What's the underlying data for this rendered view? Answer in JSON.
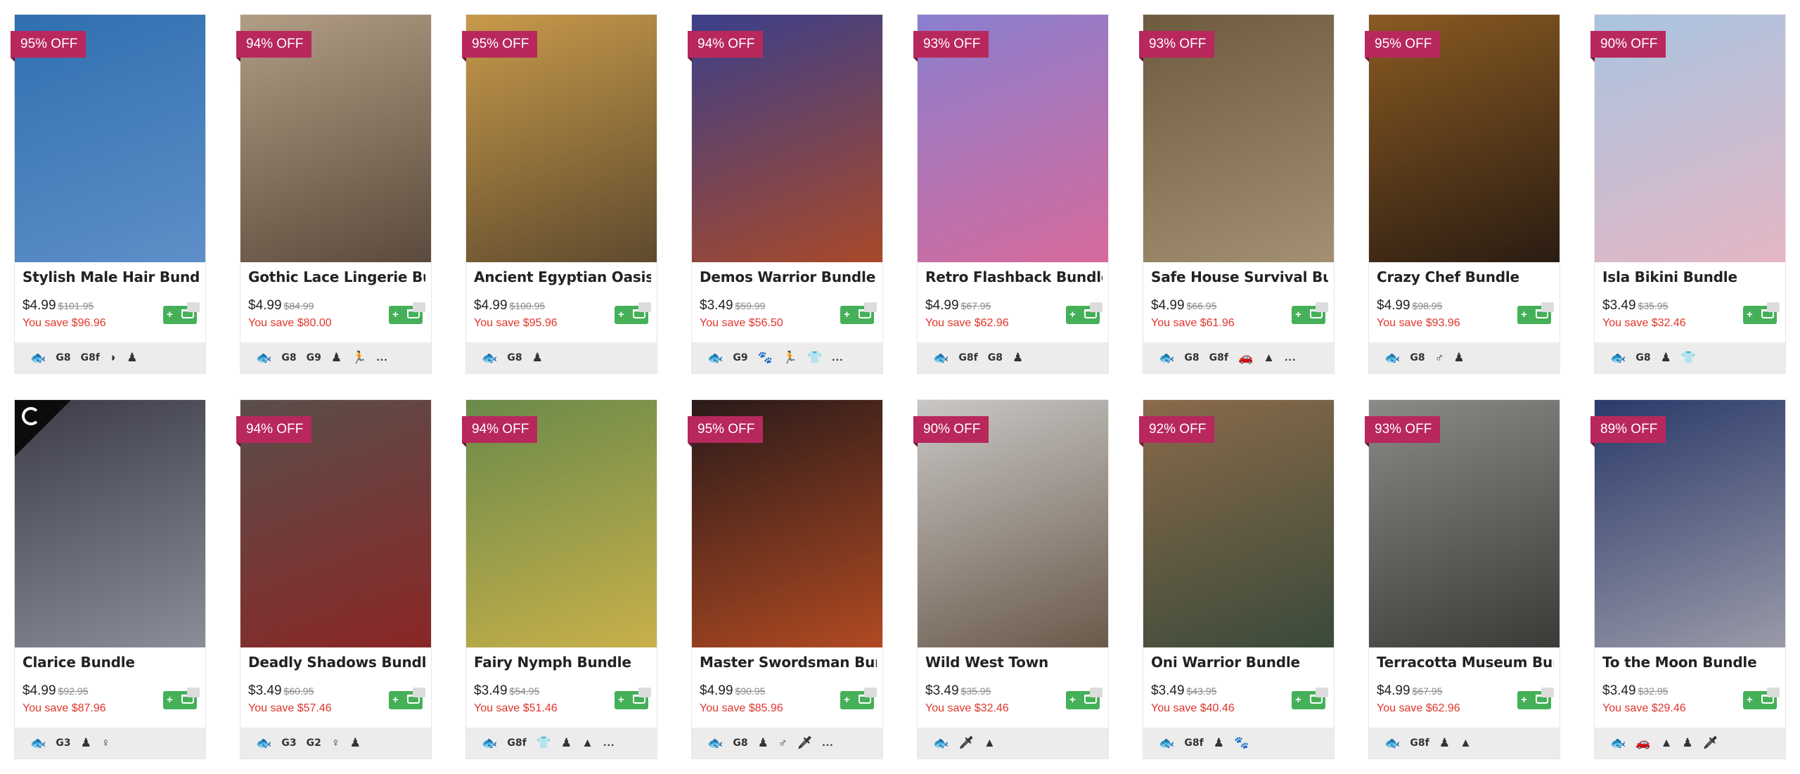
{
  "products": [
    {
      "title": "Stylish Male Hair Bundle",
      "discount": "95% OFF",
      "price": "$4.99",
      "original": "$101.95",
      "save": "You save $96.96",
      "cart": "+",
      "gradient": [
        "#2f6fb0",
        "#5f8fc8"
      ],
      "icons": [
        {
          "name": "fish-icon",
          "label": "🐟"
        },
        {
          "name": "g8-icon",
          "label": "G8"
        },
        {
          "name": "g8f-icon",
          "label": "G8f"
        },
        {
          "name": "hair-icon",
          "label": "◗"
        },
        {
          "name": "figure-icon",
          "label": "♟"
        }
      ]
    },
    {
      "title": "Gothic Lace Lingerie Bu...",
      "discount": "94% OFF",
      "price": "$4.99",
      "original": "$84.99",
      "save": "You save $80.00",
      "cart": "+",
      "gradient": [
        "#b29e84",
        "#5b4a3c"
      ],
      "icons": [
        {
          "name": "fish-icon",
          "label": "🐟"
        },
        {
          "name": "g8-icon",
          "label": "G8"
        },
        {
          "name": "g9-icon",
          "label": "G9"
        },
        {
          "name": "figure-icon",
          "label": "♟"
        },
        {
          "name": "pose-icon",
          "label": "🏃"
        },
        {
          "name": "more-icon",
          "label": "..."
        }
      ]
    },
    {
      "title": "Ancient Egyptian Oasis ...",
      "discount": "95% OFF",
      "price": "$4.99",
      "original": "$100.95",
      "save": "You save $95.96",
      "cart": "+",
      "gradient": [
        "#c89a4a",
        "#5e4a2e"
      ],
      "icons": [
        {
          "name": "fish-icon",
          "label": "🐟"
        },
        {
          "name": "g8-icon",
          "label": "G8"
        },
        {
          "name": "figure-icon",
          "label": "♟"
        }
      ]
    },
    {
      "title": "Demos Warrior Bundle",
      "discount": "94% OFF",
      "price": "$3.49",
      "original": "$59.99",
      "save": "You save $56.50",
      "cart": "+",
      "gradient": [
        "#3b3f8a",
        "#a8492a"
      ],
      "icons": [
        {
          "name": "fish-icon",
          "label": "🐟"
        },
        {
          "name": "g9-icon",
          "label": "G9"
        },
        {
          "name": "paw-icon",
          "label": "🐾"
        },
        {
          "name": "pose-icon",
          "label": "🏃"
        },
        {
          "name": "shirt-icon",
          "label": "👕"
        },
        {
          "name": "more-icon",
          "label": "..."
        }
      ]
    },
    {
      "title": "Retro Flashback Bundle",
      "discount": "93% OFF",
      "price": "$4.99",
      "original": "$67.95",
      "save": "You save $62.96",
      "cart": "+",
      "gradient": [
        "#8a7fcf",
        "#d66a9b"
      ],
      "icons": [
        {
          "name": "fish-icon",
          "label": "🐟"
        },
        {
          "name": "g8f-icon",
          "label": "G8f"
        },
        {
          "name": "g8-icon",
          "label": "G8"
        },
        {
          "name": "figure-icon",
          "label": "♟"
        }
      ]
    },
    {
      "title": "Safe House Survival Bu...",
      "discount": "93% OFF",
      "price": "$4.99",
      "original": "$66.95",
      "save": "You save $61.96",
      "cart": "+",
      "gradient": [
        "#6e5a3e",
        "#a39072"
      ],
      "icons": [
        {
          "name": "fish-icon",
          "label": "🐟"
        },
        {
          "name": "g8-icon",
          "label": "G8"
        },
        {
          "name": "g8f-icon",
          "label": "G8f"
        },
        {
          "name": "car-icon",
          "label": "🚗"
        },
        {
          "name": "mountain-icon",
          "label": "▲"
        },
        {
          "name": "more-icon",
          "label": "..."
        }
      ]
    },
    {
      "title": "Crazy Chef Bundle",
      "discount": "95% OFF",
      "price": "$4.99",
      "original": "$98.95",
      "save": "You save $93.96",
      "cart": "+",
      "gradient": [
        "#8a5a22",
        "#2a1c12"
      ],
      "icons": [
        {
          "name": "fish-icon",
          "label": "🐟"
        },
        {
          "name": "g8-icon",
          "label": "G8"
        },
        {
          "name": "male-icon",
          "label": "♂"
        },
        {
          "name": "figure-icon",
          "label": "♟"
        }
      ]
    },
    {
      "title": "Isla Bikini Bundle",
      "discount": "90% OFF",
      "price": "$3.49",
      "original": "$35.95",
      "save": "You save $32.46",
      "cart": "+",
      "gradient": [
        "#a9c4e0",
        "#e4b6c4"
      ],
      "icons": [
        {
          "name": "fish-icon",
          "label": "🐟"
        },
        {
          "name": "g8-icon",
          "label": "G8"
        },
        {
          "name": "figure-icon",
          "label": "♟"
        },
        {
          "name": "shirt-icon",
          "label": "👕"
        }
      ]
    },
    {
      "title": "Clarice Bundle",
      "discount": "",
      "price": "$4.99",
      "original": "$92.95",
      "save": "You save $87.96",
      "cart": "+",
      "gradient": [
        "#3c3c48",
        "#8a8e98"
      ],
      "icons": [
        {
          "name": "fish-icon",
          "label": "🐟"
        },
        {
          "name": "g3-icon",
          "label": "G3"
        },
        {
          "name": "figure-icon",
          "label": "♟"
        },
        {
          "name": "female-icon",
          "label": "♀"
        }
      ]
    },
    {
      "title": "Deadly Shadows Bundle",
      "discount": "94% OFF",
      "price": "$3.49",
      "original": "$60.95",
      "save": "You save $57.46",
      "cart": "+",
      "gradient": [
        "#5a4e4a",
        "#8a2626"
      ],
      "icons": [
        {
          "name": "fish-icon",
          "label": "🐟"
        },
        {
          "name": "g3-icon",
          "label": "G3"
        },
        {
          "name": "g2-icon",
          "label": "G2"
        },
        {
          "name": "female-icon",
          "label": "♀"
        },
        {
          "name": "figure-icon",
          "label": "♟"
        }
      ]
    },
    {
      "title": "Fairy Nymph Bundle",
      "discount": "94% OFF",
      "price": "$3.49",
      "original": "$54.95",
      "save": "You save $51.46",
      "cart": "+",
      "gradient": [
        "#6a8a4a",
        "#c8b04a"
      ],
      "icons": [
        {
          "name": "fish-icon",
          "label": "🐟"
        },
        {
          "name": "g8f-icon",
          "label": "G8f"
        },
        {
          "name": "shirt-icon",
          "label": "👕"
        },
        {
          "name": "figure-icon",
          "label": "♟"
        },
        {
          "name": "mountain-icon",
          "label": "▲"
        },
        {
          "name": "more-icon",
          "label": "..."
        }
      ]
    },
    {
      "title": "Master Swordsman Bun...",
      "discount": "95% OFF",
      "price": "$4.99",
      "original": "$90.95",
      "save": "You save $85.96",
      "cart": "+",
      "gradient": [
        "#2a1a1a",
        "#b04a22"
      ],
      "icons": [
        {
          "name": "fish-icon",
          "label": "🐟"
        },
        {
          "name": "g8-icon",
          "label": "G8"
        },
        {
          "name": "figure-icon",
          "label": "♟"
        },
        {
          "name": "male-icon",
          "label": "♂"
        },
        {
          "name": "sword-icon",
          "label": "🗡"
        },
        {
          "name": "more-icon",
          "label": "..."
        }
      ]
    },
    {
      "title": "Wild West Town",
      "discount": "90% OFF",
      "price": "$3.49",
      "original": "$35.95",
      "save": "You save $32.46",
      "cart": "+",
      "gradient": [
        "#c9c7c6",
        "#6a5a4a"
      ],
      "icons": [
        {
          "name": "fish-icon",
          "label": "🐟"
        },
        {
          "name": "sword-icon",
          "label": "🗡"
        },
        {
          "name": "mountain-icon",
          "label": "▲"
        }
      ]
    },
    {
      "title": "Oni Warrior Bundle",
      "discount": "92% OFF",
      "price": "$3.49",
      "original": "$43.95",
      "save": "You save $40.46",
      "cart": "+",
      "gradient": [
        "#8a6a4a",
        "#3a4a3a"
      ],
      "icons": [
        {
          "name": "fish-icon",
          "label": "🐟"
        },
        {
          "name": "g8f-icon",
          "label": "G8f"
        },
        {
          "name": "figure-icon",
          "label": "♟"
        },
        {
          "name": "paw-icon",
          "label": "🐾"
        }
      ]
    },
    {
      "title": "Terracotta Museum Bun...",
      "discount": "93% OFF",
      "price": "$4.99",
      "original": "$67.95",
      "save": "You save $62.96",
      "cart": "+",
      "gradient": [
        "#8a8a86",
        "#3a3a38"
      ],
      "icons": [
        {
          "name": "fish-icon",
          "label": "🐟"
        },
        {
          "name": "g8f-icon",
          "label": "G8f"
        },
        {
          "name": "figure-icon",
          "label": "♟"
        },
        {
          "name": "mountain-icon",
          "label": "▲"
        }
      ]
    },
    {
      "title": "To the Moon Bundle",
      "discount": "89% OFF",
      "price": "$3.49",
      "original": "$32.95",
      "save": "You save $29.46",
      "cart": "+",
      "gradient": [
        "#2a3a6a",
        "#9a9aa8"
      ],
      "icons": [
        {
          "name": "fish-icon",
          "label": "🐟"
        },
        {
          "name": "car-icon",
          "label": "🚗"
        },
        {
          "name": "mountain-icon",
          "label": "▲"
        },
        {
          "name": "figure-icon",
          "label": "♟"
        },
        {
          "name": "sword-icon",
          "label": "🗡"
        }
      ]
    }
  ]
}
